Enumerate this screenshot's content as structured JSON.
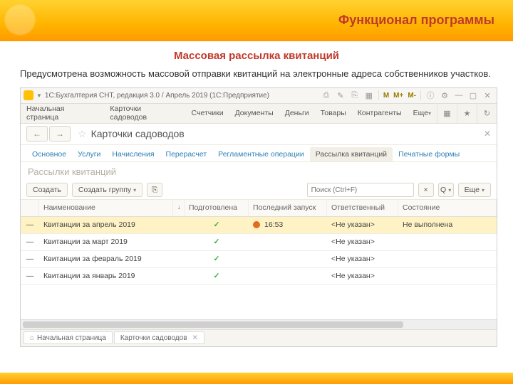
{
  "slide": {
    "header": "Функционал программы",
    "subtitle": "Массовая рассылка квитанций",
    "intro": "Предусмотрена возможность массовой отправки квитанций на электронные адреса собственников участков."
  },
  "window": {
    "title": "1С:Бухгалтерия СНТ, редакция 3.0 / Апрель 2019  (1С:Предприятие)",
    "m_labels": [
      "M",
      "M+",
      "M-"
    ]
  },
  "mainmenu": {
    "items": [
      "Начальная страница",
      "Карточки садоводов",
      "Счетчики",
      "Документы",
      "Деньги",
      "Товары",
      "Контрагенты"
    ],
    "more": "Еще"
  },
  "page": {
    "title": "Карточки садоводов",
    "section": "Рассылки квитанций"
  },
  "tabs": [
    {
      "label": "Основное"
    },
    {
      "label": "Услуги"
    },
    {
      "label": "Начисления"
    },
    {
      "label": "Перерасчет"
    },
    {
      "label": "Регламентные операции"
    },
    {
      "label": "Рассылка квитанций",
      "active": true
    },
    {
      "label": "Печатные формы"
    }
  ],
  "toolbar": {
    "create": "Создать",
    "create_group": "Создать группу",
    "search_placeholder": "Поиск (Ctrl+F)",
    "more": "Еще"
  },
  "columns": {
    "name": "Наименование",
    "prep": "Подготовлена",
    "last": "Последний запуск",
    "resp": "Ответственный",
    "state": "Состояние"
  },
  "rows": [
    {
      "name": "Квитанции за апрель 2019",
      "prep": true,
      "last_time": "16:53",
      "last_dot": true,
      "resp": "<Не указан>",
      "state": "Не выполнена",
      "sel": true
    },
    {
      "name": "Квитанции за март 2019",
      "prep": true,
      "last_time": "",
      "last_dot": false,
      "resp": "<Не указан>",
      "state": ""
    },
    {
      "name": "Квитанции за февраль 2019",
      "prep": true,
      "last_time": "",
      "last_dot": false,
      "resp": "<Не указан>",
      "state": ""
    },
    {
      "name": "Квитанции за январь 2019",
      "prep": true,
      "last_time": "",
      "last_dot": false,
      "resp": "<Не указан>",
      "state": ""
    }
  ],
  "bottom_tabs": {
    "home": "Начальная страница",
    "current": "Карточки садоводов"
  }
}
